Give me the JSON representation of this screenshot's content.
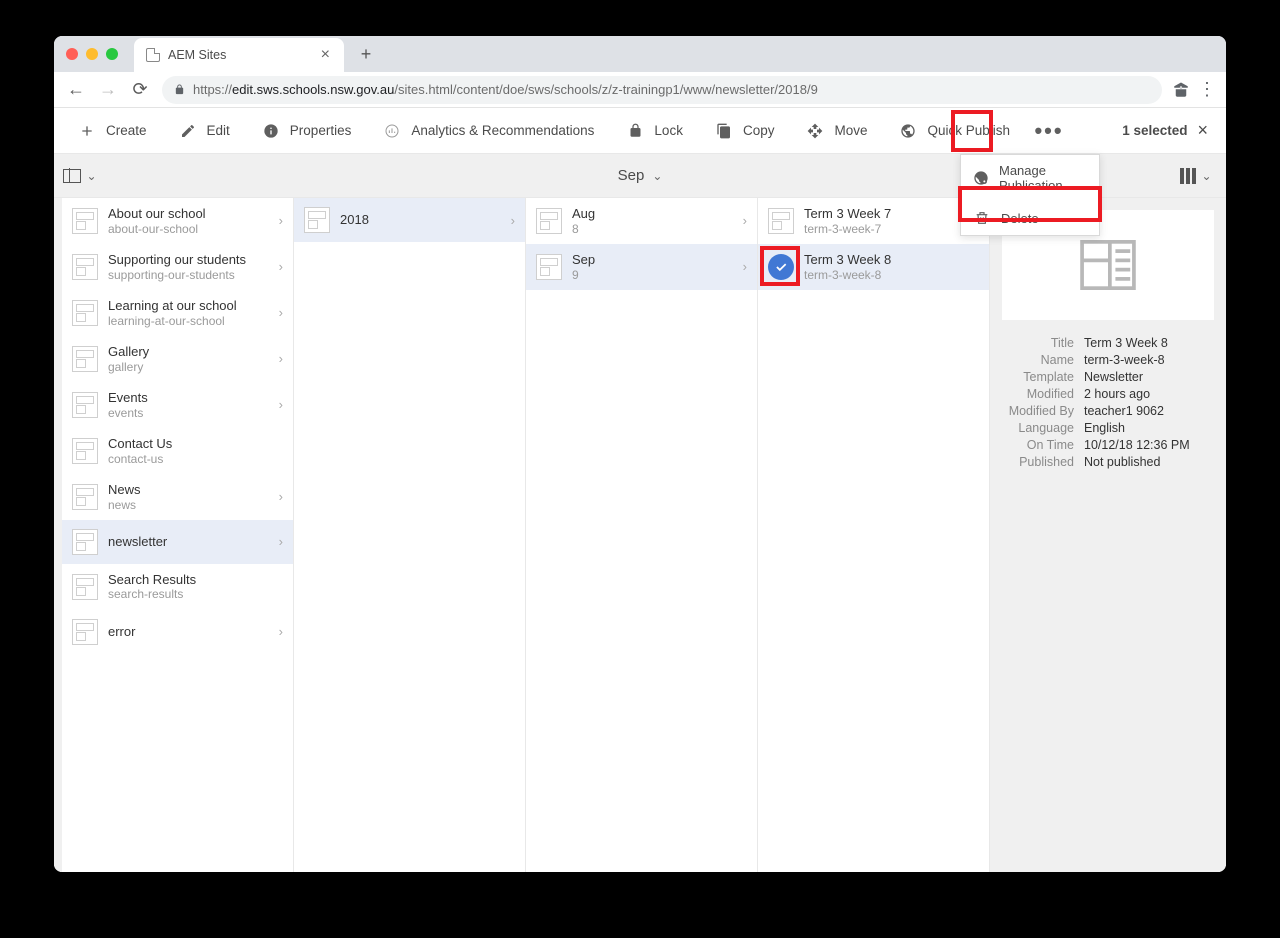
{
  "tab": {
    "title": "AEM Sites"
  },
  "url": {
    "domain": "edit.sws.schools.nsw.gov.au",
    "path": "/sites.html/content/doe/sws/schools/z/z-trainingp1/www/newsletter/2018/9",
    "prefix": "https://"
  },
  "toolbar": {
    "create": "Create",
    "edit": "Edit",
    "properties": "Properties",
    "analytics": "Analytics & Recommendations",
    "lock": "Lock",
    "copy": "Copy",
    "move": "Move",
    "quickpublish": "Quick Publish",
    "selected": "1 selected"
  },
  "breadcrumb": {
    "title": "Sep"
  },
  "dropdown": {
    "manage": "Manage Publication",
    "delete": "Delete"
  },
  "col1": [
    {
      "title": "About our school",
      "sub": "about-our-school",
      "arrow": true
    },
    {
      "title": "Supporting our students",
      "sub": "supporting-our-students",
      "arrow": true
    },
    {
      "title": "Learning at our school",
      "sub": "learning-at-our-school",
      "arrow": true
    },
    {
      "title": "Gallery",
      "sub": "gallery",
      "arrow": true
    },
    {
      "title": "Events",
      "sub": "events",
      "arrow": true
    },
    {
      "title": "Contact Us",
      "sub": "contact-us",
      "arrow": false
    },
    {
      "title": "News",
      "sub": "news",
      "arrow": true
    },
    {
      "title": "newsletter",
      "sub": "",
      "arrow": true,
      "selected": true
    },
    {
      "title": "Search Results",
      "sub": "search-results",
      "arrow": false
    },
    {
      "title": "error",
      "sub": "",
      "arrow": true
    }
  ],
  "col2": [
    {
      "title": "2018",
      "sub": "",
      "arrow": true,
      "selected": true
    }
  ],
  "col3": [
    {
      "title": "Aug",
      "sub": "8",
      "arrow": true
    },
    {
      "title": "Sep",
      "sub": "9",
      "arrow": true,
      "selected": true
    }
  ],
  "col4": [
    {
      "title": "Term 3 Week 7",
      "sub": "term-3-week-7",
      "arrow": false
    },
    {
      "title": "Term 3 Week 8",
      "sub": "term-3-week-8",
      "arrow": false,
      "checked": true,
      "selected": true
    }
  ],
  "details": {
    "title_label": "Title",
    "title": "Term 3 Week 8",
    "name_label": "Name",
    "name": "term-3-week-8",
    "template_label": "Template",
    "template": "Newsletter",
    "modified_label": "Modified",
    "modified": "2 hours ago",
    "modifiedby_label": "Modified By",
    "modifiedby": "teacher1 9062",
    "language_label": "Language",
    "language": "English",
    "ontime_label": "On Time",
    "ontime": "10/12/18 12:36 PM",
    "published_label": "Published",
    "published": "Not published"
  }
}
